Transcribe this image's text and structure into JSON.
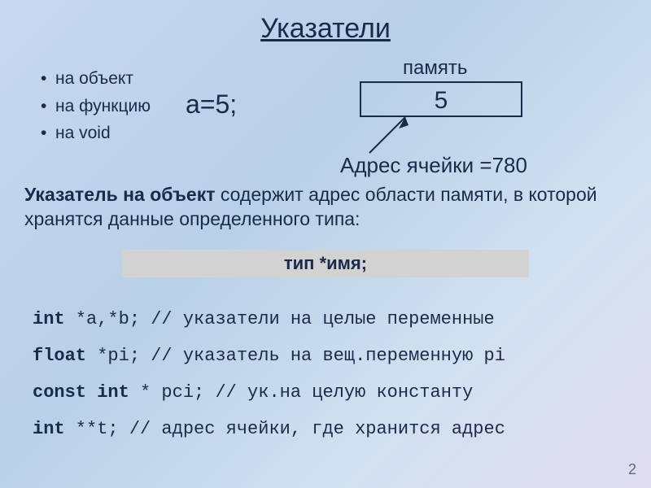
{
  "title": "Указатели",
  "bullets": {
    "b1": "на объект",
    "b2": "на функцию",
    "b3": "на void"
  },
  "expression": "a=5;",
  "memory": {
    "label": "память",
    "value": "5",
    "address": "Адрес ячейки =780"
  },
  "description": {
    "bold": "Указатель на объект",
    "rest": " содержит адрес области памяти, в которой хранятся данные определенного типа:"
  },
  "typebar": "тип *имя;",
  "code": {
    "l1kw": "int",
    "l1rest": " *a,*b; // указатели на целые переменные",
    "l2kw": "float",
    "l2rest": " *pi; // указатель на вещ.переменную pi",
    "l3kw": "const int",
    "l3rest": " * pci; // ук.на целую константу",
    "l4kw": "int",
    "l4rest": " **t; // адрес ячейки, где хранится адрес"
  },
  "slidenum": "2"
}
